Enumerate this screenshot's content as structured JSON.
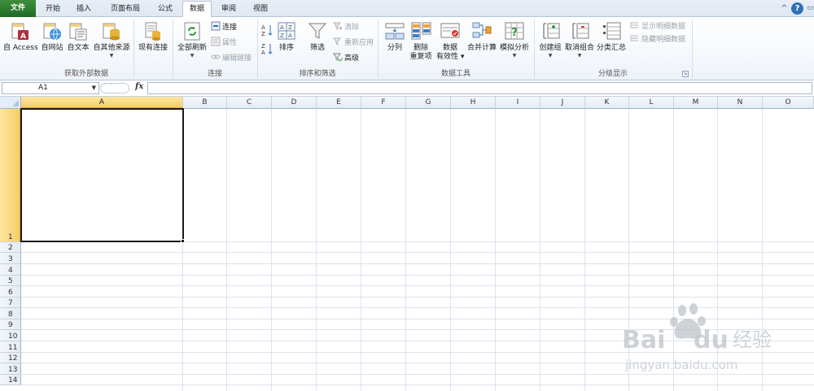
{
  "tabs": [
    {
      "label": "文件"
    },
    {
      "label": "开始"
    },
    {
      "label": "插入"
    },
    {
      "label": "页面布局"
    },
    {
      "label": "公式"
    },
    {
      "label": "数据"
    },
    {
      "label": "审阅"
    },
    {
      "label": "视图"
    }
  ],
  "window_controls": {
    "minimize": "^",
    "help": "?",
    "restore": "▭",
    "close": "×"
  },
  "ribbon": {
    "external_data": {
      "group_label": "获取外部数据",
      "from_access": "自 Access",
      "from_web": "自网站",
      "from_text": "自文本",
      "from_other": "自其他来源",
      "existing": "现有连接"
    },
    "connections": {
      "group_label": "连接",
      "refresh_all": "全部刷新",
      "connections": "连接",
      "properties": "属性",
      "edit_links": "编辑链接"
    },
    "sort_filter": {
      "group_label": "排序和筛选",
      "sort": "排序",
      "filter": "筛选",
      "clear": "清除",
      "reapply": "重新应用",
      "advanced": "高级"
    },
    "data_tools": {
      "group_label": "数据工具",
      "text_to_columns": "分列",
      "remove_dup_1": "删除",
      "remove_dup_2": "重复项",
      "validation_1": "数据",
      "validation_2": "有效性",
      "consolidate": "合并计算",
      "what_if": "模拟分析"
    },
    "outline": {
      "group_label": "分级显示",
      "group": "创建组",
      "ungroup": "取消组合",
      "subtotal": "分类汇总",
      "show_detail": "显示明细数据",
      "hide_detail": "隐藏明细数据"
    }
  },
  "formula_bar": {
    "name_box": "A1",
    "fx": "fx",
    "value": ""
  },
  "columns": [
    "A",
    "B",
    "C",
    "D",
    "E",
    "F",
    "G",
    "H",
    "I",
    "J",
    "K",
    "L",
    "M",
    "N",
    "O"
  ],
  "rows": [
    "1",
    "2",
    "3",
    "4",
    "5",
    "6",
    "7",
    "8",
    "9",
    "10",
    "11",
    "12",
    "13",
    "14"
  ],
  "watermark": {
    "brand": "Bai",
    "brand2": "du",
    "cn": "经验",
    "url": "jingyan.baidu.com"
  },
  "colors": {
    "file_tab": "#2a7a2e",
    "selection": "#f8cd6a",
    "grid_line": "#dce3ec"
  }
}
